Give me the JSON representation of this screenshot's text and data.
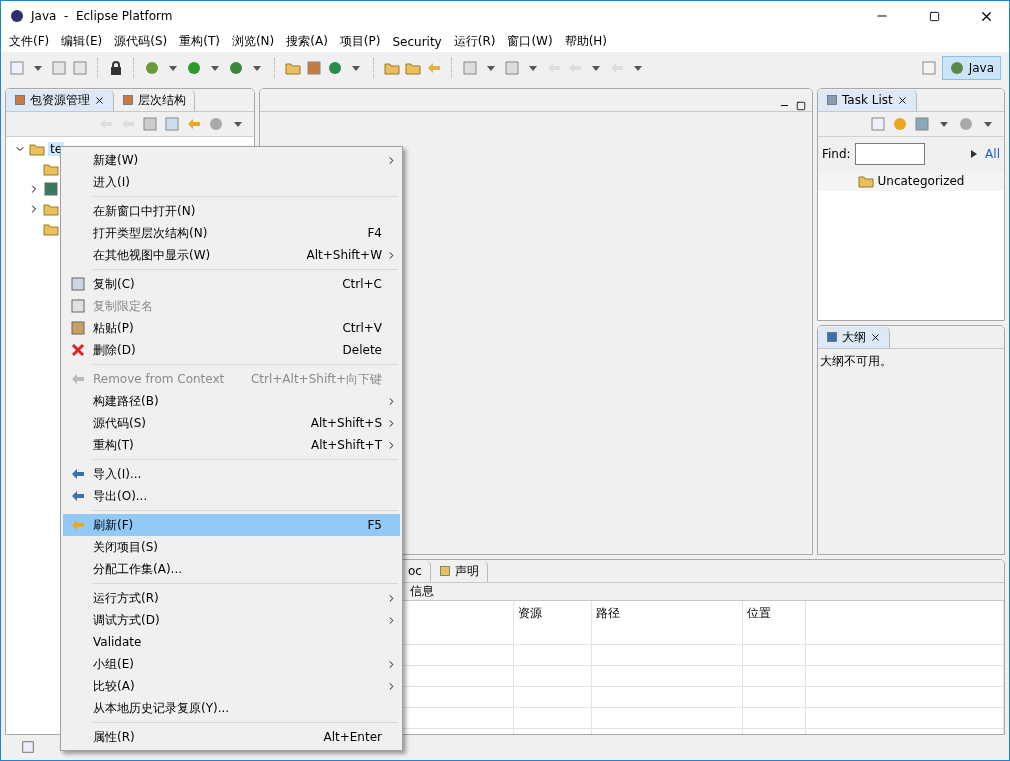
{
  "window": {
    "title": "Java  -  Eclipse Platform"
  },
  "menu_bar": [
    "文件(F)",
    "编辑(E)",
    "源代码(S)",
    "重构(T)",
    "浏览(N)",
    "搜索(A)",
    "项目(P)",
    "Security",
    "运行(R)",
    "窗口(W)",
    "帮助(H)"
  ],
  "perspectives": [
    {
      "label": "Java",
      "selected": true
    }
  ],
  "package_explorer": {
    "tabs": [
      {
        "label": "包资源管理",
        "selected": true
      },
      {
        "label": "层次结构",
        "selected": false
      }
    ],
    "tree": [
      {
        "label": "te",
        "selected": true,
        "expanded": true,
        "children": [
          {
            "kind": "folder"
          },
          {
            "kind": "library",
            "expanded": false
          },
          {
            "kind": "folder",
            "expanded": false
          },
          {
            "kind": "folder"
          }
        ]
      }
    ]
  },
  "task_list": {
    "tab": "Task List",
    "find_label": "Find:",
    "all_link": "All",
    "category": "Uncategorized"
  },
  "outline": {
    "tab": "大纲",
    "message": "大纲不可用。"
  },
  "bottom_panel": {
    "tabs": [
      {
        "label": "oc",
        "selected": false
      },
      {
        "label": "声明",
        "selected": false
      }
    ],
    "title": "信息",
    "columns": [
      "",
      "资源",
      "路径",
      "位置",
      ""
    ]
  },
  "context_menu": [
    [
      {
        "label": "新建(W)",
        "submenu": true,
        "disabled": false,
        "selected": false
      },
      {
        "label": "进入(I)",
        "submenu": false,
        "disabled": false,
        "selected": false
      }
    ],
    [
      {
        "label": "在新窗口中打开(N)",
        "submenu": false,
        "disabled": false,
        "selected": false
      },
      {
        "label": "打开类型层次结构(N)",
        "shortcut": "F4",
        "submenu": false,
        "disabled": false,
        "selected": false
      },
      {
        "label": "在其他视图中显示(W)",
        "shortcut": "Alt+Shift+W",
        "submenu": true,
        "disabled": false,
        "selected": false
      }
    ],
    [
      {
        "label": "复制(C)",
        "shortcut": "Ctrl+C",
        "submenu": false,
        "disabled": false,
        "selected": false
      },
      {
        "label": "复制限定名",
        "submenu": false,
        "disabled": true,
        "selected": false
      },
      {
        "label": "粘贴(P)",
        "shortcut": "Ctrl+V",
        "submenu": false,
        "disabled": false,
        "selected": false
      },
      {
        "label": "删除(D)",
        "shortcut": "Delete",
        "submenu": false,
        "disabled": false,
        "selected": false
      }
    ],
    [
      {
        "label": "Remove from Context",
        "shortcut": "Ctrl+Alt+Shift+向下键",
        "submenu": false,
        "disabled": true,
        "selected": false
      },
      {
        "label": "构建路径(B)",
        "submenu": true,
        "disabled": false,
        "selected": false
      },
      {
        "label": "源代码(S)",
        "shortcut": "Alt+Shift+S",
        "submenu": true,
        "disabled": false,
        "selected": false
      },
      {
        "label": "重构(T)",
        "shortcut": "Alt+Shift+T",
        "submenu": true,
        "disabled": false,
        "selected": false
      }
    ],
    [
      {
        "label": "导入(I)...",
        "submenu": false,
        "disabled": false,
        "selected": false
      },
      {
        "label": "导出(O)...",
        "submenu": false,
        "disabled": false,
        "selected": false
      }
    ],
    [
      {
        "label": "刷新(F)",
        "shortcut": "F5",
        "submenu": false,
        "disabled": false,
        "selected": true
      },
      {
        "label": "关闭项目(S)",
        "submenu": false,
        "disabled": false,
        "selected": false
      },
      {
        "label": "分配工作集(A)...",
        "submenu": false,
        "disabled": false,
        "selected": false
      }
    ],
    [
      {
        "label": "运行方式(R)",
        "submenu": true,
        "disabled": false,
        "selected": false
      },
      {
        "label": "调试方式(D)",
        "submenu": true,
        "disabled": false,
        "selected": false
      },
      {
        "label": "Validate",
        "submenu": false,
        "disabled": false,
        "selected": false
      },
      {
        "label": "小组(E)",
        "submenu": true,
        "disabled": false,
        "selected": false
      },
      {
        "label": "比较(A)",
        "submenu": true,
        "disabled": false,
        "selected": false
      },
      {
        "label": "从本地历史记录复原(Y)...",
        "submenu": false,
        "disabled": false,
        "selected": false
      }
    ],
    [
      {
        "label": "属性(R)",
        "shortcut": "Alt+Enter",
        "submenu": false,
        "disabled": false,
        "selected": false
      }
    ]
  ]
}
